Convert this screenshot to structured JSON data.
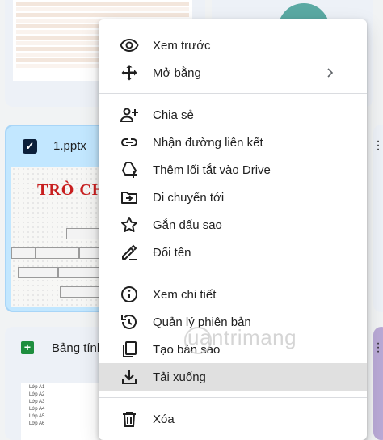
{
  "files": {
    "pptx_name": "1.pptx",
    "slide_title": "TRÒ CHƠ",
    "sheet_name": "Bảng tính",
    "sheet_rows": [
      "Lớp A1",
      "Lớp A2",
      "Lớp A3",
      "Lớp A4",
      "Lớp A5",
      "Lớp A6"
    ]
  },
  "menu": {
    "items": [
      {
        "label": "Xem trước",
        "icon": "eye-icon"
      },
      {
        "label": "Mở bằng",
        "icon": "open-with-icon",
        "submenu": true
      },
      {
        "label": "Chia sẻ",
        "icon": "person-add-icon"
      },
      {
        "label": "Nhận đường liên kết",
        "icon": "link-icon"
      },
      {
        "label": "Thêm lối tắt vào Drive",
        "icon": "add-shortcut-icon"
      },
      {
        "label": "Di chuyển tới",
        "icon": "move-to-folder-icon"
      },
      {
        "label": "Gắn dấu sao",
        "icon": "star-icon"
      },
      {
        "label": "Đổi tên",
        "icon": "rename-pencil-icon"
      },
      {
        "label": "Xem chi tiết",
        "icon": "info-icon"
      },
      {
        "label": "Quản lý phiên bản",
        "icon": "history-icon"
      },
      {
        "label": "Tạo bản sao",
        "icon": "copy-icon"
      },
      {
        "label": "Tải xuống",
        "icon": "download-icon",
        "highlighted": true
      },
      {
        "label": "Xóa",
        "icon": "trash-icon"
      }
    ]
  },
  "watermark": "uantrimang",
  "colors": {
    "selected_card": "#c2e7ff",
    "menu_highlight": "#e0e0e0",
    "slide_title": "#c81f1f",
    "sheets_green": "#1e8e3e"
  }
}
